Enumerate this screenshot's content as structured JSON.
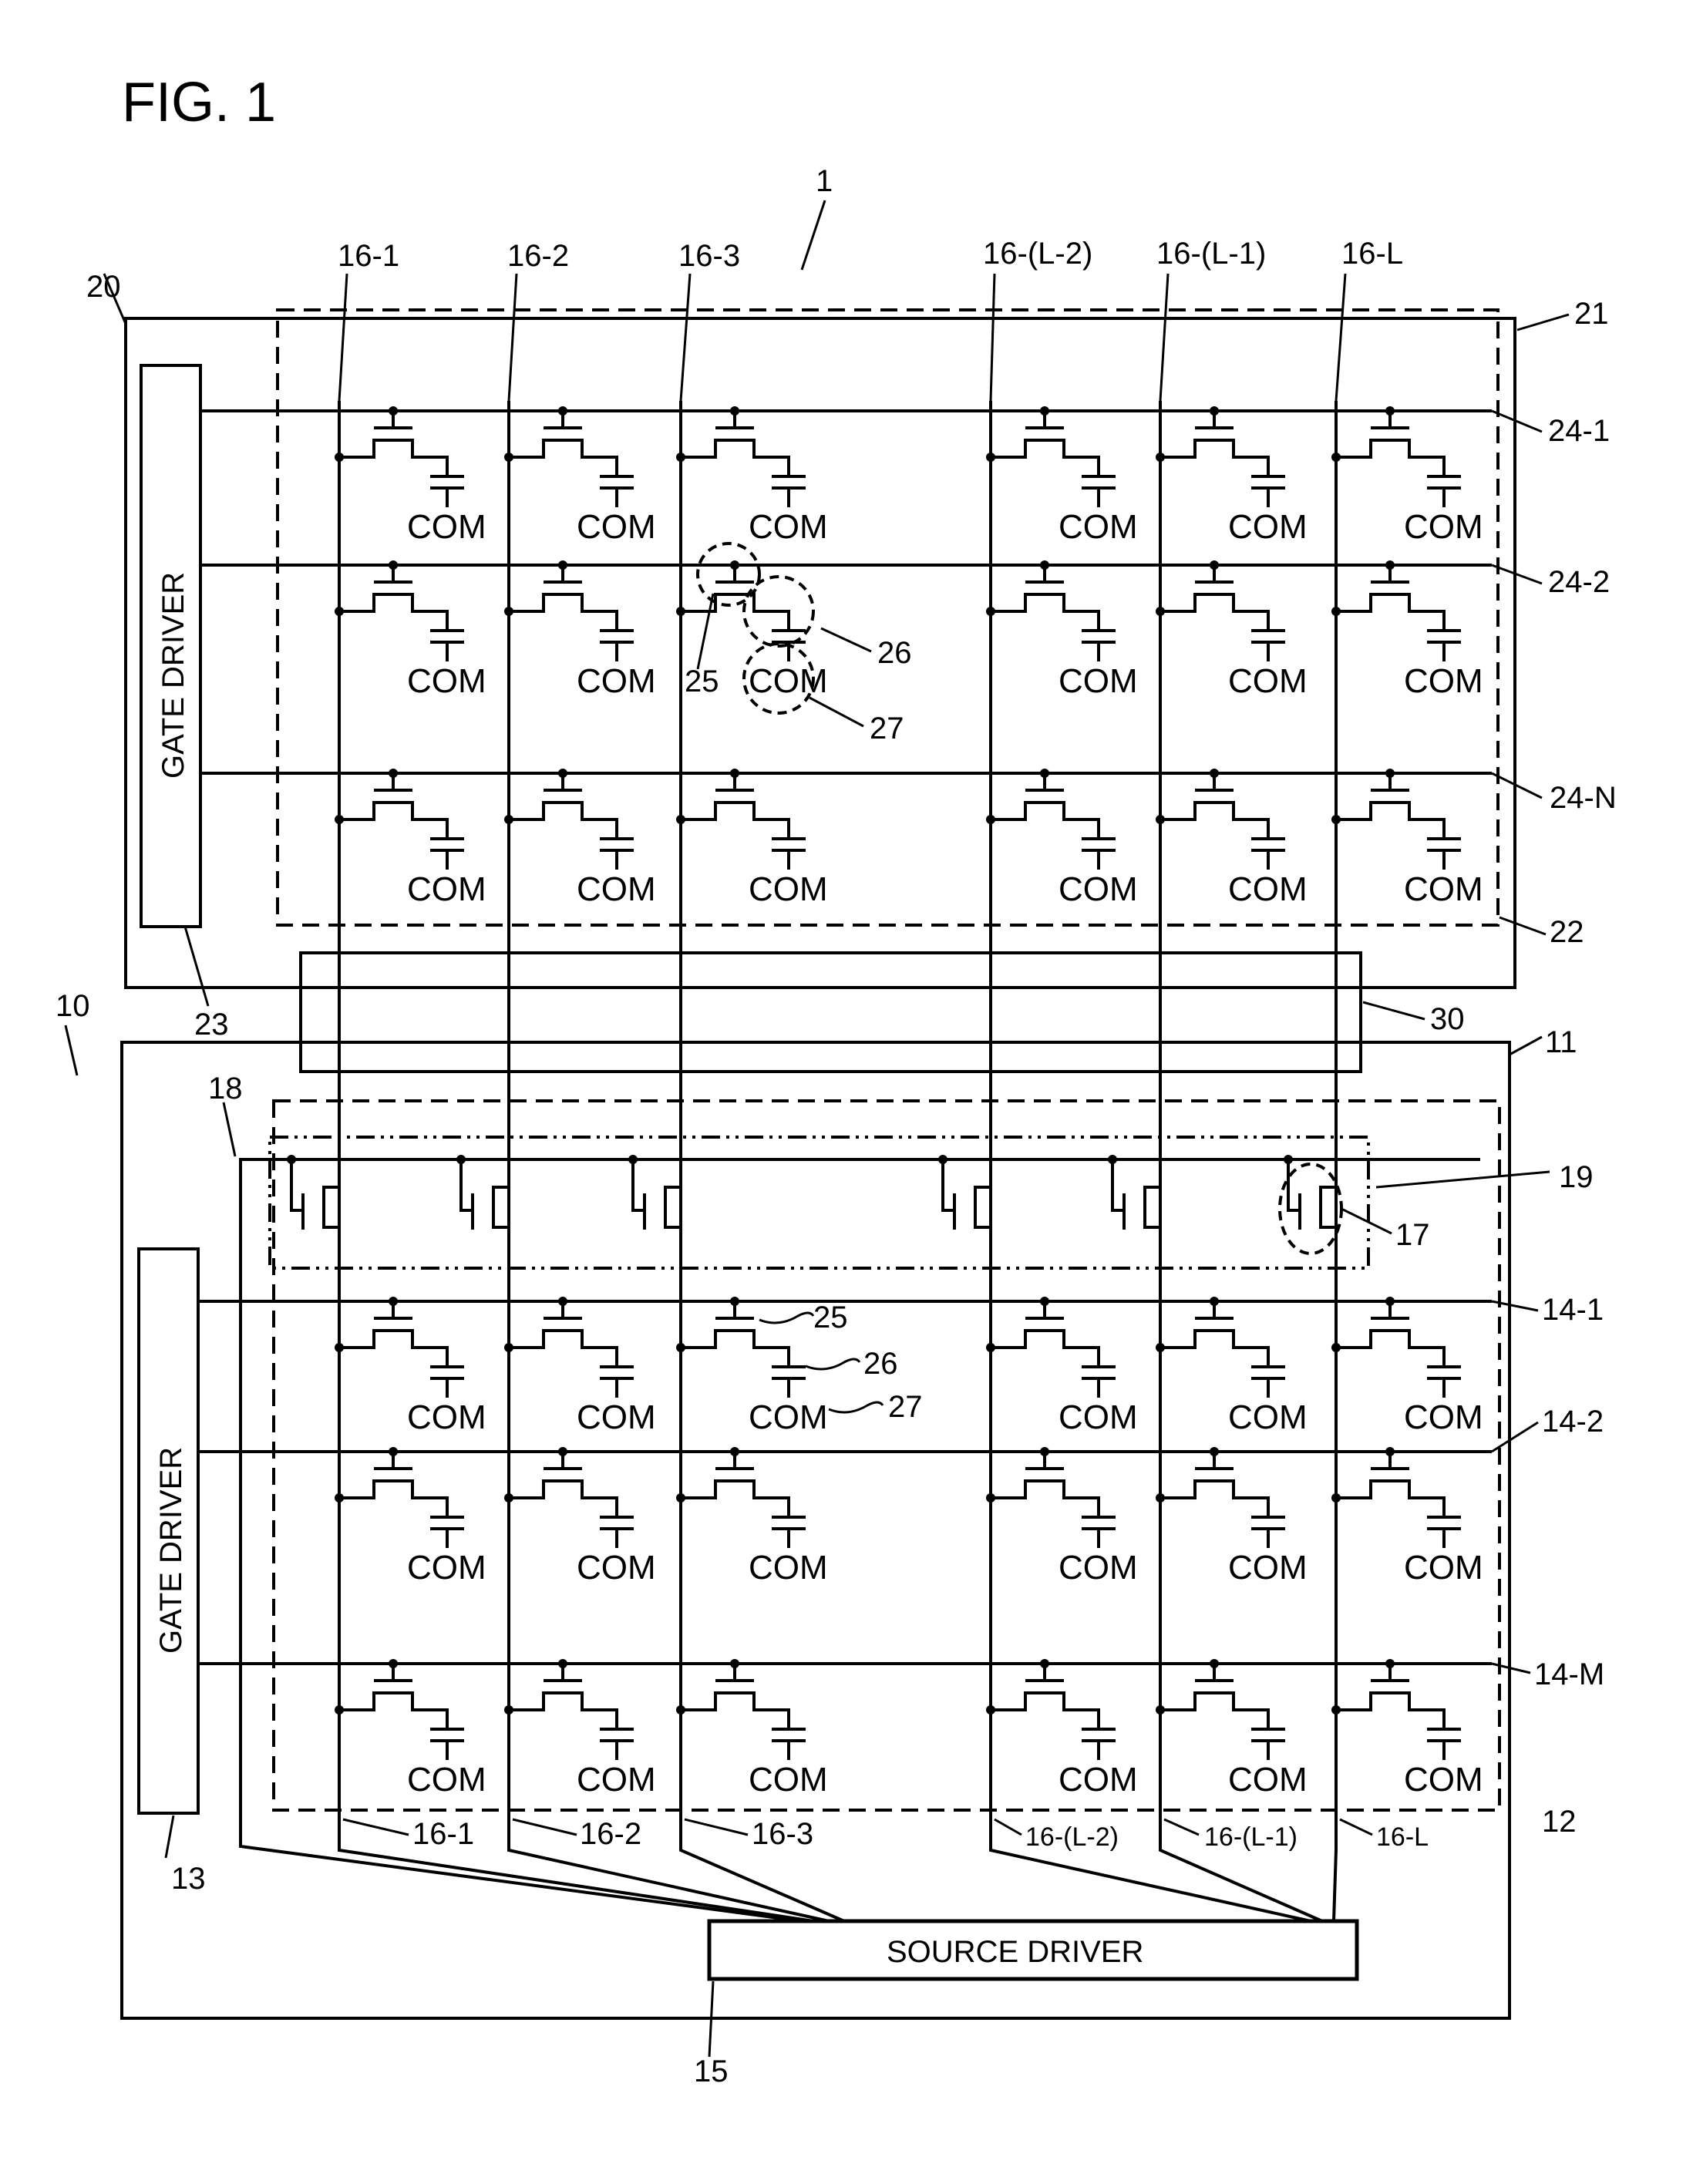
{
  "figure": {
    "title": "FIG. 1",
    "overall_ref": "1"
  },
  "upper_panel": {
    "ref": "20",
    "substrate_ref": "21",
    "pixel_area_ref": "22",
    "gate_driver": {
      "label": "GATE DRIVER",
      "ref": "23"
    },
    "gate_lines": [
      "24-1",
      "24-2",
      "24-N"
    ],
    "detail_refs": {
      "transistor": "25",
      "capacitor": "26",
      "common": "27"
    }
  },
  "connector": {
    "ref": "30"
  },
  "lower_panel": {
    "ref": "10",
    "substrate_ref": "11",
    "pixel_area_ref": "12",
    "gate_driver": {
      "label": "GATE DRIVER",
      "ref": "13"
    },
    "source_driver": {
      "label": "SOURCE DRIVER",
      "ref": "15"
    },
    "gate_lines": [
      "14-1",
      "14-2",
      "14-M"
    ],
    "switch_control_line_ref": "18",
    "switch_block_ref": "19",
    "switch_transistor_ref": "17",
    "detail_refs": {
      "transistor": "25",
      "capacitor": "26",
      "common": "27"
    }
  },
  "source_lines": [
    "16-1",
    "16-2",
    "16-3",
    "16-(L-2)",
    "16-(L-1)",
    "16-L"
  ],
  "common_label": "COM"
}
